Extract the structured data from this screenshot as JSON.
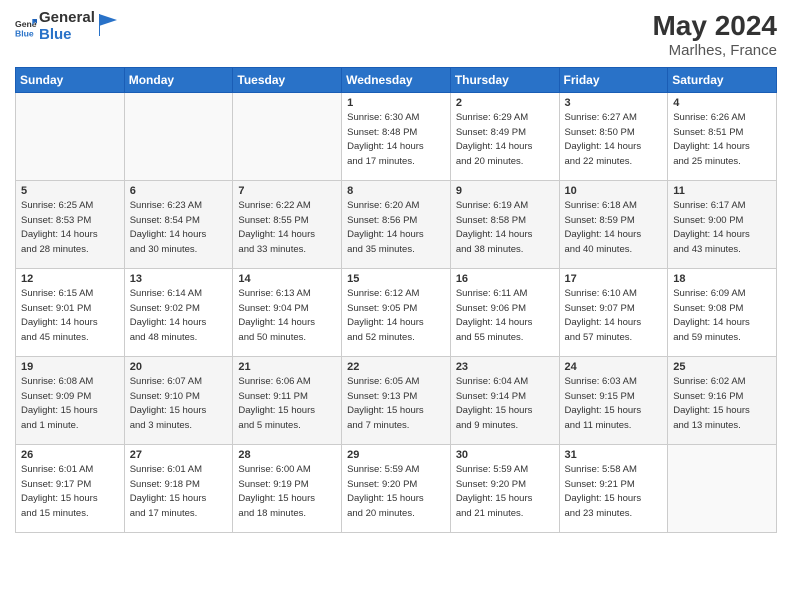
{
  "logo": {
    "line1": "General",
    "line2": "Blue"
  },
  "title": "May 2024",
  "location": "Marlhes, France",
  "days_of_week": [
    "Sunday",
    "Monday",
    "Tuesday",
    "Wednesday",
    "Thursday",
    "Friday",
    "Saturday"
  ],
  "weeks": [
    [
      {
        "num": "",
        "info": ""
      },
      {
        "num": "",
        "info": ""
      },
      {
        "num": "",
        "info": ""
      },
      {
        "num": "1",
        "info": "Sunrise: 6:30 AM\nSunset: 8:48 PM\nDaylight: 14 hours\nand 17 minutes."
      },
      {
        "num": "2",
        "info": "Sunrise: 6:29 AM\nSunset: 8:49 PM\nDaylight: 14 hours\nand 20 minutes."
      },
      {
        "num": "3",
        "info": "Sunrise: 6:27 AM\nSunset: 8:50 PM\nDaylight: 14 hours\nand 22 minutes."
      },
      {
        "num": "4",
        "info": "Sunrise: 6:26 AM\nSunset: 8:51 PM\nDaylight: 14 hours\nand 25 minutes."
      }
    ],
    [
      {
        "num": "5",
        "info": "Sunrise: 6:25 AM\nSunset: 8:53 PM\nDaylight: 14 hours\nand 28 minutes."
      },
      {
        "num": "6",
        "info": "Sunrise: 6:23 AM\nSunset: 8:54 PM\nDaylight: 14 hours\nand 30 minutes."
      },
      {
        "num": "7",
        "info": "Sunrise: 6:22 AM\nSunset: 8:55 PM\nDaylight: 14 hours\nand 33 minutes."
      },
      {
        "num": "8",
        "info": "Sunrise: 6:20 AM\nSunset: 8:56 PM\nDaylight: 14 hours\nand 35 minutes."
      },
      {
        "num": "9",
        "info": "Sunrise: 6:19 AM\nSunset: 8:58 PM\nDaylight: 14 hours\nand 38 minutes."
      },
      {
        "num": "10",
        "info": "Sunrise: 6:18 AM\nSunset: 8:59 PM\nDaylight: 14 hours\nand 40 minutes."
      },
      {
        "num": "11",
        "info": "Sunrise: 6:17 AM\nSunset: 9:00 PM\nDaylight: 14 hours\nand 43 minutes."
      }
    ],
    [
      {
        "num": "12",
        "info": "Sunrise: 6:15 AM\nSunset: 9:01 PM\nDaylight: 14 hours\nand 45 minutes."
      },
      {
        "num": "13",
        "info": "Sunrise: 6:14 AM\nSunset: 9:02 PM\nDaylight: 14 hours\nand 48 minutes."
      },
      {
        "num": "14",
        "info": "Sunrise: 6:13 AM\nSunset: 9:04 PM\nDaylight: 14 hours\nand 50 minutes."
      },
      {
        "num": "15",
        "info": "Sunrise: 6:12 AM\nSunset: 9:05 PM\nDaylight: 14 hours\nand 52 minutes."
      },
      {
        "num": "16",
        "info": "Sunrise: 6:11 AM\nSunset: 9:06 PM\nDaylight: 14 hours\nand 55 minutes."
      },
      {
        "num": "17",
        "info": "Sunrise: 6:10 AM\nSunset: 9:07 PM\nDaylight: 14 hours\nand 57 minutes."
      },
      {
        "num": "18",
        "info": "Sunrise: 6:09 AM\nSunset: 9:08 PM\nDaylight: 14 hours\nand 59 minutes."
      }
    ],
    [
      {
        "num": "19",
        "info": "Sunrise: 6:08 AM\nSunset: 9:09 PM\nDaylight: 15 hours\nand 1 minute."
      },
      {
        "num": "20",
        "info": "Sunrise: 6:07 AM\nSunset: 9:10 PM\nDaylight: 15 hours\nand 3 minutes."
      },
      {
        "num": "21",
        "info": "Sunrise: 6:06 AM\nSunset: 9:11 PM\nDaylight: 15 hours\nand 5 minutes."
      },
      {
        "num": "22",
        "info": "Sunrise: 6:05 AM\nSunset: 9:13 PM\nDaylight: 15 hours\nand 7 minutes."
      },
      {
        "num": "23",
        "info": "Sunrise: 6:04 AM\nSunset: 9:14 PM\nDaylight: 15 hours\nand 9 minutes."
      },
      {
        "num": "24",
        "info": "Sunrise: 6:03 AM\nSunset: 9:15 PM\nDaylight: 15 hours\nand 11 minutes."
      },
      {
        "num": "25",
        "info": "Sunrise: 6:02 AM\nSunset: 9:16 PM\nDaylight: 15 hours\nand 13 minutes."
      }
    ],
    [
      {
        "num": "26",
        "info": "Sunrise: 6:01 AM\nSunset: 9:17 PM\nDaylight: 15 hours\nand 15 minutes."
      },
      {
        "num": "27",
        "info": "Sunrise: 6:01 AM\nSunset: 9:18 PM\nDaylight: 15 hours\nand 17 minutes."
      },
      {
        "num": "28",
        "info": "Sunrise: 6:00 AM\nSunset: 9:19 PM\nDaylight: 15 hours\nand 18 minutes."
      },
      {
        "num": "29",
        "info": "Sunrise: 5:59 AM\nSunset: 9:20 PM\nDaylight: 15 hours\nand 20 minutes."
      },
      {
        "num": "30",
        "info": "Sunrise: 5:59 AM\nSunset: 9:20 PM\nDaylight: 15 hours\nand 21 minutes."
      },
      {
        "num": "31",
        "info": "Sunrise: 5:58 AM\nSunset: 9:21 PM\nDaylight: 15 hours\nand 23 minutes."
      },
      {
        "num": "",
        "info": ""
      }
    ]
  ]
}
